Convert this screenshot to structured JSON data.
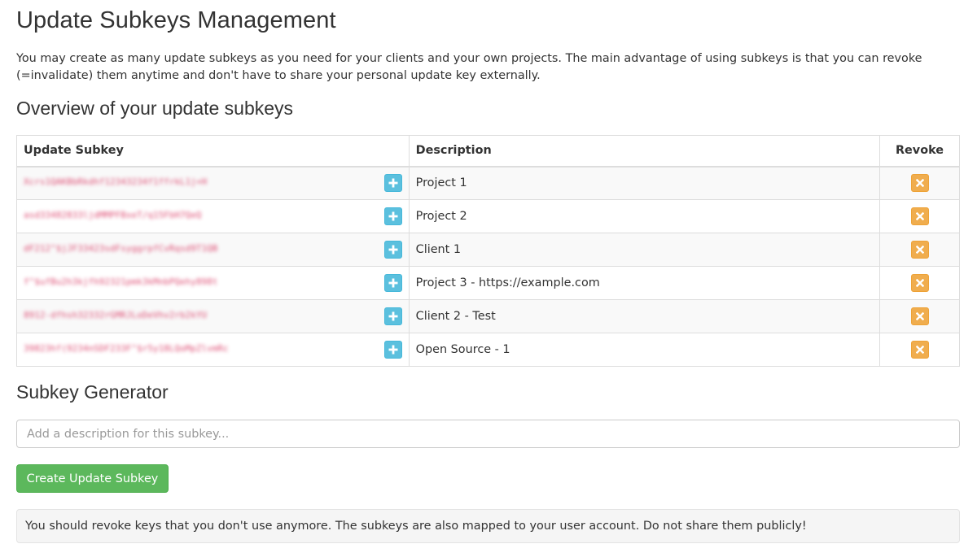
{
  "page": {
    "title": "Update Subkeys Management",
    "intro": "You may create as many update subkeys as you need for your clients and your own projects. The main advantage of using subkeys is that you can revoke (=invalidate) them anytime and don't have to share your personal update key externally."
  },
  "overview": {
    "heading": "Overview of your update subkeys",
    "columns": {
      "subkey": "Update Subkey",
      "description": "Description",
      "revoke": "Revoke"
    },
    "rows": [
      {
        "key": "Xcrs1QAKBbRkdhf12343234f1ffrkL1j+H",
        "description": "Project 1"
      },
      {
        "key": "asd33482833ljdMMPFBxeT/q15FbH7QeQ",
        "description": "Project 2"
      },
      {
        "key": "dF212\"$jJF33423sdFsyggrpfCvRqsd9T1QB",
        "description": "Client 1"
      },
      {
        "key": "f\"$ufBu2h3kjfh92321pmk3kMnbPQehy898t",
        "description": "Project 3 - https://example.com"
      },
      {
        "key": "8912-dfhsh32332rGMRJLoDeVhv2rb2kYU",
        "description": "Client 2 - Test"
      },
      {
        "key": "39823hf(9234nSDF233F\"$r5y18LQoMpZlvmRc",
        "description": "Open Source - 1"
      }
    ]
  },
  "generator": {
    "heading": "Subkey Generator",
    "placeholder": "Add a description for this subkey...",
    "value": "",
    "button_label": "Create Update Subkey"
  },
  "notice": "You should revoke keys that you don't use anymore. The subkeys are also mapped to your user account. Do not share them publicly!",
  "colors": {
    "copy_button": "#5bc0de",
    "revoke_button": "#f0ad4e",
    "create_button": "#5cb85c",
    "blurred_key_text": "#d9335f"
  },
  "icons": {
    "copy": "plus-icon",
    "revoke": "close-icon"
  }
}
